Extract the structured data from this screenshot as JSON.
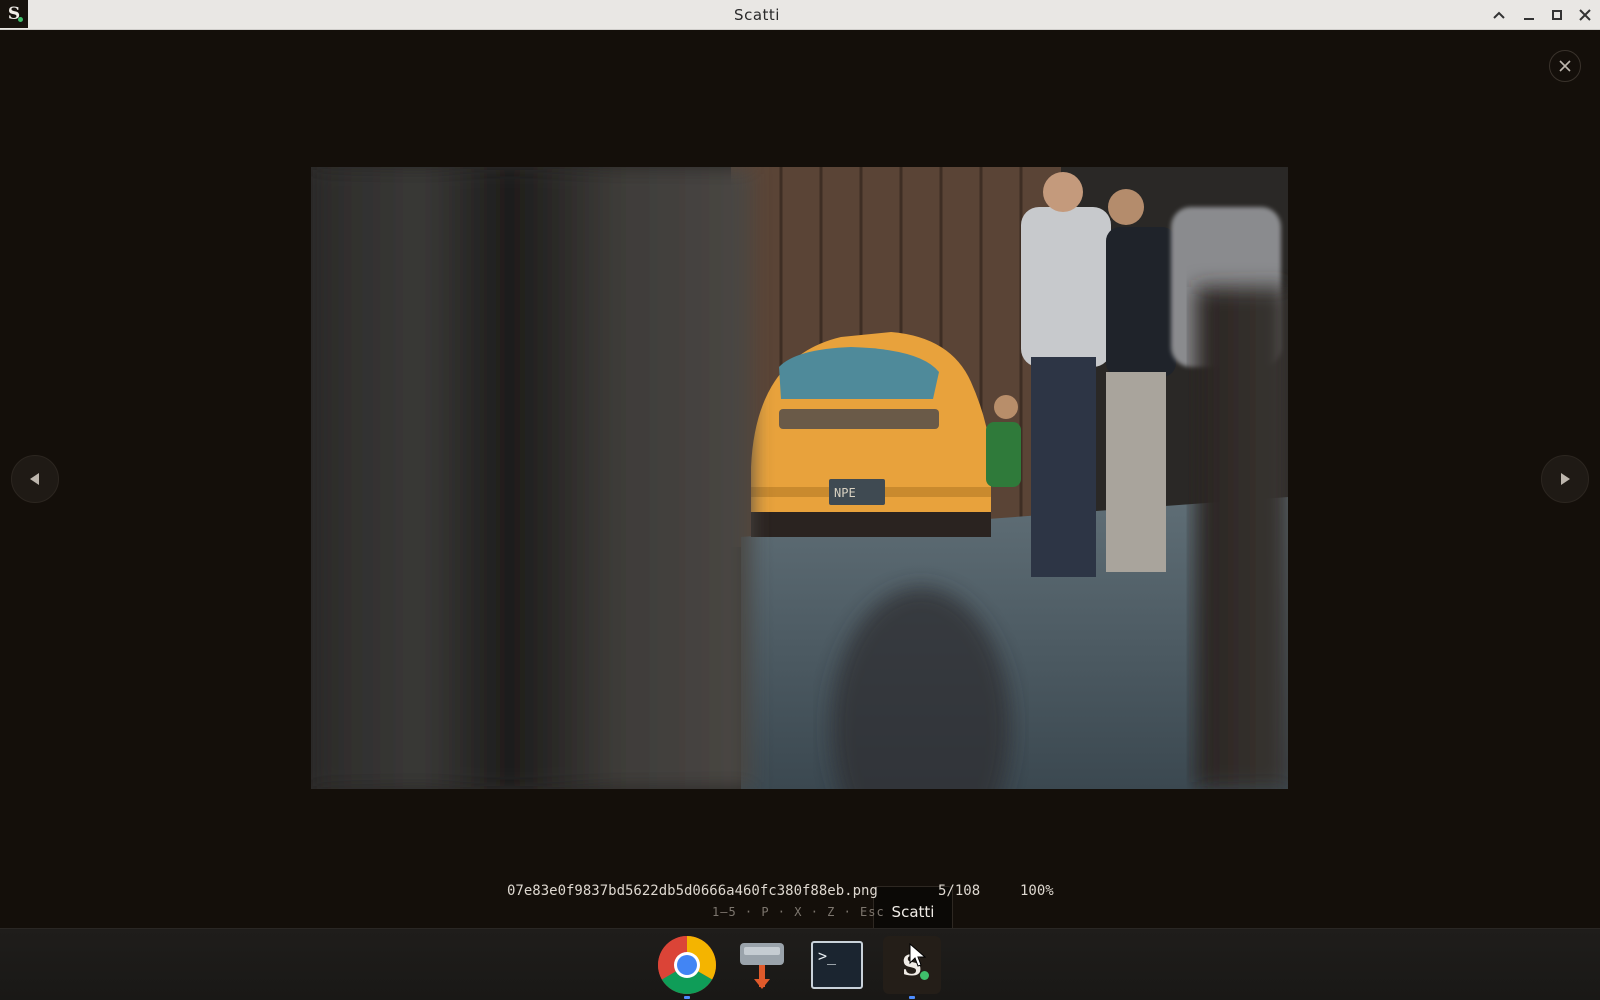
{
  "window": {
    "title": "Scatti",
    "app_icon_letter": "S"
  },
  "viewer": {
    "filename": "07e83e0f9837bd5622db5d0666a460fc380f88eb.png",
    "counter": "5/108",
    "zoom": "100%",
    "shortcuts": "1–5 · P · X · Z · Esc",
    "photo_description_hidden": null
  },
  "tooltip": {
    "text": "Scatti"
  },
  "taskbar": {
    "items": [
      {
        "name": "chrome",
        "running": true
      },
      {
        "name": "installer",
        "running": false
      },
      {
        "name": "terminal",
        "running": false,
        "label": ">_"
      },
      {
        "name": "scatti",
        "running": true,
        "label": "S"
      }
    ]
  },
  "colors": {
    "background": "#140f0a",
    "car": "#e8a23c",
    "accent_green": "#3fbf6b"
  }
}
